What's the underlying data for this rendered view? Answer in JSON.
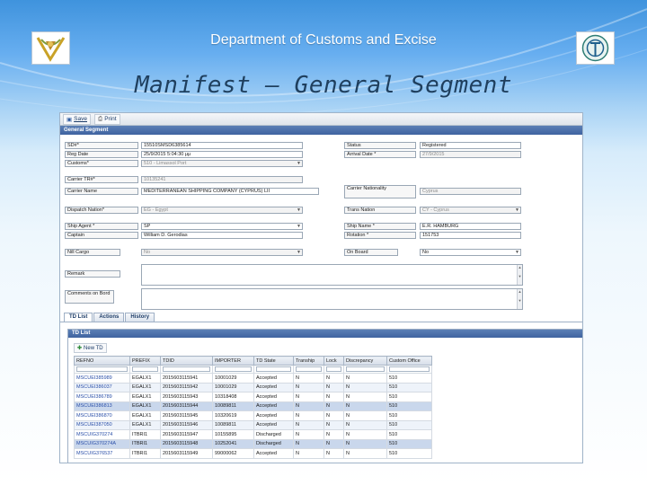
{
  "slide": {
    "header": "Department of Customs and Excise",
    "title": "Manifest – General Segment"
  },
  "toolbar": {
    "save_label": "Save",
    "print_label": "Print"
  },
  "general_segment": {
    "header": "General Segment",
    "sd_label": "SD#",
    "sd_value": "15510SMSD6385614",
    "status_label": "Status",
    "status_value": "Registered",
    "reg_date_label": "Reg Date",
    "reg_date_value": "25/9/2015 5:04:30 μμ",
    "arrival_label": "Arrival Date",
    "arrival_value": "27/9/2015",
    "customs_label": "Customs",
    "customs_value": "510 - Limassol Port",
    "carrier_tr_label": "Carrier TR#",
    "carrier_tr_value": "10135241",
    "carrier_name_label": "Carrier Name",
    "carrier_name_value": "MEDITERRANEAN SHIPPING COMPANY (CYPRUS) LII",
    "carrier_nat_label": "Carrier Nationality",
    "carrier_nat_value": "Cyprus",
    "dispatch_label": "Dispatch Nation",
    "dispatch_value": "EG - Egypt",
    "trans_label": "Trans Nation",
    "trans_value": "CY - Cyprus",
    "ship_agent_label": "Ship Agent",
    "ship_agent_value": "SP",
    "ship_name_label": "Ship Name",
    "ship_name_value": "E.R. HAMBURG",
    "captain_label": "Captain",
    "captain_value": "William D. Gerodias",
    "rotation_label": "Rotation",
    "rotation_value": "151753",
    "nill_label": "Nill Cargo",
    "nill_value": "No",
    "onboard_label": "On Board",
    "onboard_value": "No",
    "remark_label": "Remark",
    "comments_label": "Comments on Bord",
    "required_mark": "*"
  },
  "tabs": [
    {
      "label": "TD List"
    },
    {
      "label": "Actions"
    },
    {
      "label": "History"
    }
  ],
  "td_list": {
    "header": "TD List",
    "new_td_label": "New TD",
    "columns": [
      "REFNO",
      "PREFIX",
      "TDID",
      "IMPORTER",
      "TD State",
      "Tranship",
      "Lock",
      "Discrepancy",
      "Custom Office"
    ],
    "rows": [
      [
        "MSCUEI385989",
        "EGALX1",
        "2015603115941",
        "10001029",
        "Accepted",
        "N",
        "N",
        "N",
        "510"
      ],
      [
        "MSCUEI386037",
        "EGALX1",
        "2015603115942",
        "10001029",
        "Accepted",
        "N",
        "N",
        "N",
        "510"
      ],
      [
        "MSCUEI386789",
        "EGALX1",
        "2015603115943",
        "10318408",
        "Accepted",
        "N",
        "N",
        "N",
        "510"
      ],
      [
        "MSCUEI386813",
        "EGALX1",
        "2015603115944",
        "10089811",
        "Accepted",
        "N",
        "N",
        "N",
        "510"
      ],
      [
        "MSCUEI386870",
        "EGALX1",
        "2015603115945",
        "10320619",
        "Accepted",
        "N",
        "N",
        "N",
        "510"
      ],
      [
        "MSCUEI387050",
        "EGALX1",
        "2015603115946",
        "10089811",
        "Accepted",
        "N",
        "N",
        "N",
        "510"
      ],
      [
        "MSCUIG370274",
        "ITBRI1",
        "2015603115947",
        "10155895",
        "Discharged",
        "N",
        "N",
        "N",
        "510"
      ],
      [
        "MSCUIG370274A",
        "ITBRI1",
        "2015603115948",
        "10252041",
        "Discharged",
        "N",
        "N",
        "N",
        "510"
      ],
      [
        "MSCUIG376537",
        "ITBRI1",
        "2015603115949",
        "99000062",
        "Accepted",
        "N",
        "N",
        "N",
        "510"
      ]
    ]
  },
  "colors": {
    "accent": "#3f63a0",
    "link": "#2a4fa8"
  }
}
